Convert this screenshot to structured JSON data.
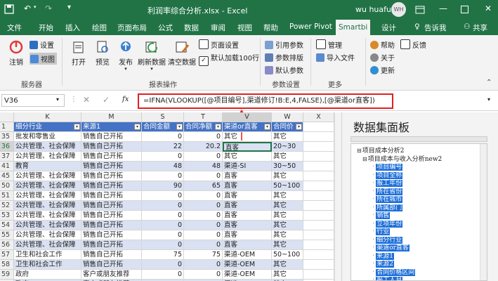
{
  "titlebar": {
    "doc_title": "利润率综合分析.xlsx  -  Excel",
    "user_name": "wu huafu",
    "avatar_initials": "WH"
  },
  "menu": {
    "tabs": [
      "文件",
      "开始",
      "插入",
      "绘图",
      "页面布局",
      "公式",
      "数据",
      "审阅",
      "视图",
      "帮助",
      "Power Pivot",
      "Smartbi",
      "设计",
      "告诉我",
      "共享"
    ],
    "active": "Smartbi"
  },
  "ribbon": {
    "groups": {
      "server": "服务器",
      "report": "报表操作",
      "params": "参数设置",
      "more": "更多"
    },
    "buttons": {
      "logout": "注销",
      "settings": "设置",
      "view": "视图",
      "open": "打开",
      "preview": "预览",
      "publish": "发布",
      "refresh": "刷新数据",
      "clear": "清空数据",
      "page_setup": "页面设置",
      "default_load": "默认加载100行",
      "ref_params": "引用参数",
      "param_layout": "参数排版",
      "default_params": "默认参数",
      "manage": "管理",
      "import_file": "导入文件",
      "help": "帮助",
      "feedback": "反馈",
      "about": "关于",
      "update": "更新"
    }
  },
  "formula_bar": {
    "name_box": "V36",
    "fx": "fx",
    "formula": "=IFNA(VLOOKUP([@项目编号],渠道修订!B:E,4,FALSE),[@渠道or直客])"
  },
  "sheet": {
    "columns": [
      "K",
      "M",
      "S",
      "T",
      "V",
      "W",
      "X"
    ],
    "selected_column": "V",
    "header_row_num": "1",
    "headers": [
      "细分行业",
      "来源1",
      "合同金额",
      "合同净额",
      "渠道or直客",
      "合同价"
    ],
    "rows": [
      {
        "n": "35",
        "k": "批发和零售业",
        "m": "销售自己开拓",
        "s": "0",
        "t": "0",
        "v": "其它",
        "w": "其它"
      },
      {
        "n": "36",
        "k": "公共管理、社会保障",
        "m": "销售自己开拓",
        "s": "22",
        "t": "20.2",
        "v": "直客",
        "w": "20~30"
      },
      {
        "n": "37",
        "k": "公共管理、社会保障",
        "m": "销售自己开拓",
        "s": "0",
        "t": "0",
        "v": "其它",
        "w": "其它"
      },
      {
        "n": "41",
        "k": "教育",
        "m": "销售自己开拓",
        "s": "48",
        "t": "48",
        "v": "渠道-SI",
        "w": "30~50"
      },
      {
        "n": "45",
        "k": "公共管理、社会保障",
        "m": "销售自己开拓",
        "s": "0",
        "t": "0",
        "v": "直客",
        "w": "其它"
      },
      {
        "n": "50",
        "k": "公共管理、社会保障",
        "m": "销售自己开拓",
        "s": "90",
        "t": "65",
        "v": "直客",
        "w": "50~100"
      },
      {
        "n": "51",
        "k": "公共管理、社会保障",
        "m": "销售自己开拓",
        "s": "0",
        "t": "0",
        "v": "直客",
        "w": "其它"
      },
      {
        "n": "52",
        "k": "公共管理、社会保障",
        "m": "销售自己开拓",
        "s": "0",
        "t": "0",
        "v": "直客",
        "w": "其它"
      },
      {
        "n": "53",
        "k": "公共管理、社会保障",
        "m": "销售自己开拓",
        "s": "0",
        "t": "0",
        "v": "直客",
        "w": "其它"
      },
      {
        "n": "54",
        "k": "公共管理、社会保障",
        "m": "销售自己开拓",
        "s": "0",
        "t": "0",
        "v": "直客",
        "w": "其它"
      },
      {
        "n": "55",
        "k": "公共管理、社会保障",
        "m": "销售自己开拓",
        "s": "0",
        "t": "0",
        "v": "直客",
        "w": "其它"
      },
      {
        "n": "56",
        "k": "公共管理、社会保障",
        "m": "销售自己开拓",
        "s": "0",
        "t": "0",
        "v": "直客",
        "w": "其它"
      },
      {
        "n": "57",
        "k": "卫生和社会工作",
        "m": "销售自己开拓",
        "s": "75",
        "t": "75",
        "v": "渠道-OEM",
        "w": "50~100"
      },
      {
        "n": "58",
        "k": "卫生和社会工作",
        "m": "销售自己开拓",
        "s": "0",
        "t": "0",
        "v": "渠道-OEM",
        "w": "其它"
      },
      {
        "n": "59",
        "k": "政府",
        "m": "客户或朋友推荐",
        "s": "0",
        "t": "0",
        "v": "渠道-OEM",
        "w": "其它"
      },
      {
        "n": "60",
        "k": "政府",
        "m": "客户或朋友推荐",
        "s": "0",
        "t": "0",
        "v": "渠道-OEM",
        "w": "其它"
      }
    ]
  },
  "panel": {
    "title": "数据集面板",
    "tree": [
      {
        "label": "项目成本分析2",
        "hl": false,
        "lvl": 0,
        "box": "minus"
      },
      {
        "label": "项目成本与收入分析new2",
        "hl": false,
        "lvl": 1,
        "box": "minus"
      },
      {
        "label": "项目编号",
        "hl": true,
        "lvl": 2
      },
      {
        "label": "项目全称",
        "hl": true,
        "lvl": 2
      },
      {
        "label": "报工年份",
        "hl": true,
        "lvl": 2
      },
      {
        "label": "所在省份",
        "hl": true,
        "lvl": 2
      },
      {
        "label": "所在城市",
        "hl": true,
        "lvl": 2
      },
      {
        "label": "所属部门",
        "hl": true,
        "lvl": 2
      },
      {
        "label": "销售",
        "hl": true,
        "lvl": 2
      },
      {
        "label": "立项年份",
        "hl": true,
        "lvl": 2
      },
      {
        "label": "行业",
        "hl": true,
        "lvl": 2
      },
      {
        "label": "细分行业",
        "hl": true,
        "lvl": 2
      },
      {
        "label": "渠道or直客",
        "hl": true,
        "lvl": 2
      },
      {
        "label": "来源1",
        "hl": true,
        "lvl": 2
      },
      {
        "label": "来源2",
        "hl": true,
        "lvl": 2
      },
      {
        "label": "合同价格区间",
        "hl": true,
        "lvl": 2
      },
      {
        "label": "报工人月",
        "hl": true,
        "lvl": 2
      },
      {
        "label": "加班人月",
        "hl": true,
        "lvl": 2
      }
    ]
  },
  "colors": {
    "excel_green": "#217346",
    "table_header": "#4472c4",
    "band": "#d9e1f2",
    "highlight": "#1e6fd9",
    "formula_border": "#e02020"
  }
}
